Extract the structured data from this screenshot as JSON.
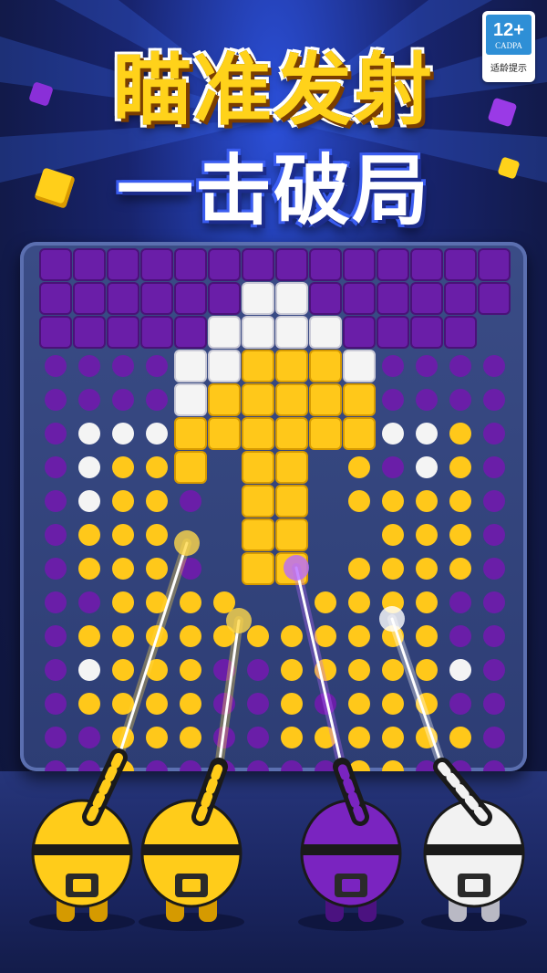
{
  "headline": {
    "line1": "瞄准发射",
    "line2": "一击破局"
  },
  "age_rating": {
    "label": "12+",
    "org": "CADPA",
    "caption": "适龄提示"
  },
  "colors": {
    "purple": "#6a1ea8",
    "yellow": "#ffc81a",
    "white": "#f4f4f4",
    "board": "#34457e"
  },
  "shooters": [
    {
      "color": "yellow",
      "name": "yellow-shooter"
    },
    {
      "color": "yellow",
      "name": "yellow-shooter"
    },
    {
      "color": "purple",
      "name": "purple-shooter"
    },
    {
      "color": "white",
      "name": "white-shooter"
    }
  ]
}
